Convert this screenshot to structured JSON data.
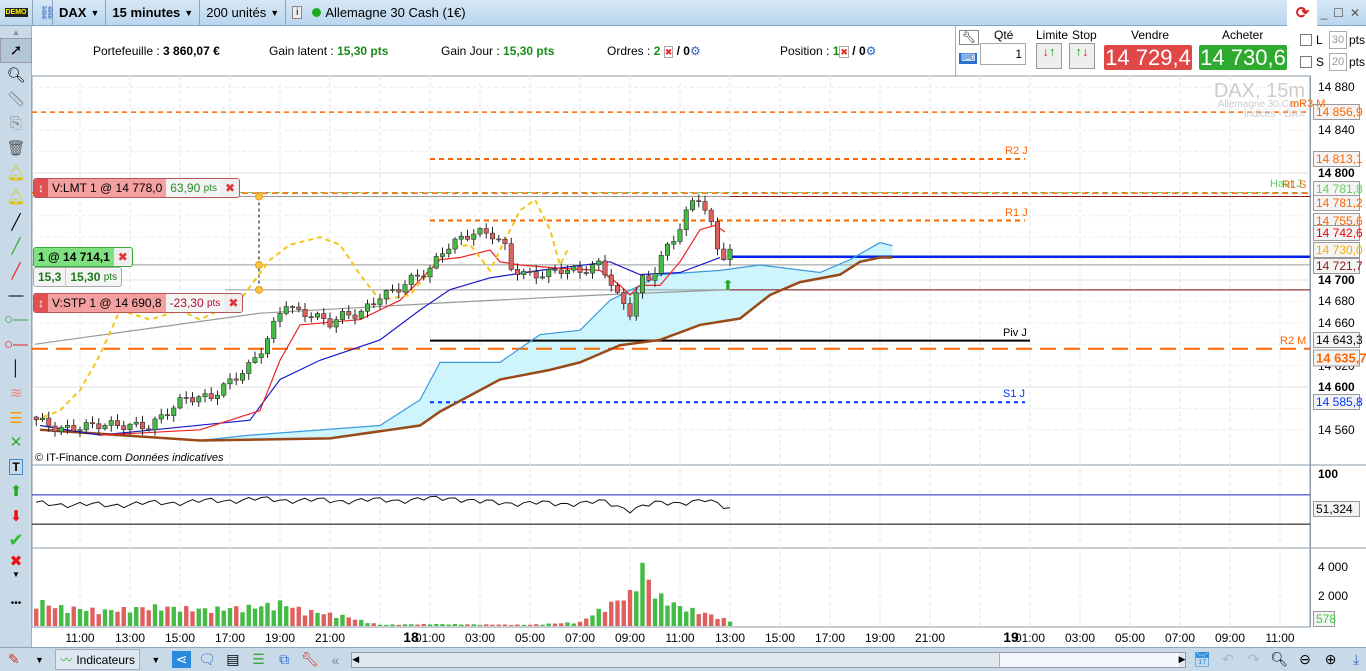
{
  "topbar": {
    "demo": "DEMO",
    "symbol": "DAX",
    "timeframe": "15 minutes",
    "units": "200 unités",
    "instrument": "Allemagne 30 Cash (1€)"
  },
  "infobar": {
    "portfolio_label": "Portefeuille :",
    "portfolio_value": "3 860,07 €",
    "latent_label": "Gain latent :",
    "latent_value": "15,30 pts",
    "day_label": "Gain Jour :",
    "day_value": "15,30 pts",
    "orders_label": "Ordres :",
    "orders_count": "2",
    "orders_sep": "/ 0",
    "position_label": "Position :",
    "position_count": "1",
    "position_sep": "/ 0"
  },
  "orderpanel": {
    "qty_label": "Qté",
    "qty_value": "1",
    "limit_label": "Limite",
    "stop_label": "Stop",
    "sell_label": "Vendre",
    "sell_price": "14 729,4",
    "buy_label": "Acheter",
    "buy_price": "14 730,6",
    "l_label": "L",
    "l_pts": "30",
    "s_label": "S",
    "s_pts": "20",
    "pts": "pts"
  },
  "orders": {
    "limit": {
      "text": "V:LMT  1 @ 14 778,0",
      "pts": "63,90",
      "unit": "pts"
    },
    "entry": {
      "text": "1 @ 14 714,1",
      "pts1": "15,3",
      "pts2": "15,30",
      "unit": "pts"
    },
    "stop": {
      "text": "V:STP  1 @ 14 690,8",
      "pts": "-23,30",
      "unit": "pts"
    }
  },
  "watermark": {
    "title": "DAX, 15m",
    "sub1": "Allemagne 30 Cash",
    "sub2": "Indices - DAX"
  },
  "copyright": {
    "text": "© IT-Finance.com",
    "note": "Données indicatives"
  },
  "levels": [
    {
      "label": "mR3 M",
      "price": 14856.9,
      "color": "#ff6600"
    },
    {
      "label": "R2 J",
      "price": 14813.1,
      "color": "#ff6600"
    },
    {
      "label": "Haut J",
      "price": 14781.8,
      "color": "#66cc66"
    },
    {
      "label": "R1 S",
      "price": 14781.2,
      "color": "#ff6600"
    },
    {
      "label": "R1 J",
      "price": 14755.6,
      "color": "#ff6600"
    },
    {
      "label": "Piv J",
      "price": 14643.3,
      "color": "#000000"
    },
    {
      "label": "R2 M",
      "price": 14635.7,
      "color": "#ff6600"
    },
    {
      "label": "S1 J",
      "price": 14585.8,
      "color": "#0033ff"
    }
  ],
  "price_labels": [
    {
      "text": "14 856,9",
      "price": 14856.9,
      "color": "#ff6600"
    },
    {
      "text": "14 813,1",
      "price": 14813.1,
      "color": "#ff6600"
    },
    {
      "text": "14 781,8",
      "price": 14781.8,
      "color": "#66cc66"
    },
    {
      "text": "14 781,2",
      "price": 14781.2,
      "color": "#ff6600"
    },
    {
      "text": "14 755,6",
      "price": 14755.6,
      "color": "#ff6600"
    },
    {
      "text": "14 742,6",
      "price": 14742.6,
      "color": "#ee0000"
    },
    {
      "text": "14 730,0",
      "price": 14730.0,
      "color": "#f0b000"
    },
    {
      "text": "14 721,7",
      "price": 14721.7,
      "color": "#8b1a1a"
    },
    {
      "text": "14 643,3",
      "price": 14643.3,
      "color": "#000000"
    },
    {
      "text": "14 635,7",
      "price": 14635.7,
      "color": "#ff6600"
    },
    {
      "text": "14 585,8",
      "price": 14585.8,
      "color": "#0033ff"
    }
  ],
  "price_ticks": [
    {
      "text": "14 880",
      "v": 14880
    },
    {
      "text": "14 840",
      "v": 14840
    },
    {
      "text": "14 800",
      "v": 14800,
      "bold": true
    },
    {
      "text": "14 700",
      "v": 14700,
      "bold": true
    },
    {
      "text": "14 680",
      "v": 14680
    },
    {
      "text": "14 660",
      "v": 14660
    },
    {
      "text": "14 620",
      "v": 14620
    },
    {
      "text": "14 600",
      "v": 14600,
      "bold": true
    },
    {
      "text": "14 560",
      "v": 14560
    }
  ],
  "osc": {
    "tick": "100",
    "value_label": "51,324"
  },
  "volume": {
    "ticks": [
      "4 000",
      "2 000"
    ],
    "value_label": "578"
  },
  "time_axis": [
    {
      "t": 11,
      "label": "11:00"
    },
    {
      "t": 13,
      "label": "13:00"
    },
    {
      "t": 15,
      "label": "15:00"
    },
    {
      "t": 17,
      "label": "17:00"
    },
    {
      "t": 19,
      "label": "19:00"
    },
    {
      "t": 21,
      "label": "21:00"
    },
    {
      "t": 24,
      "label": "18",
      "day": true
    },
    {
      "t": 25,
      "label": "01:00"
    },
    {
      "t": 27,
      "label": "03:00"
    },
    {
      "t": 29,
      "label": "05:00"
    },
    {
      "t": 31,
      "label": "07:00"
    },
    {
      "t": 33,
      "label": "09:00"
    },
    {
      "t": 35,
      "label": "11:00"
    },
    {
      "t": 37,
      "label": "13:00"
    },
    {
      "t": 39,
      "label": "15:00"
    },
    {
      "t": 41,
      "label": "17:00"
    },
    {
      "t": 43,
      "label": "19:00"
    },
    {
      "t": 45,
      "label": "21:00"
    },
    {
      "t": 48,
      "label": "19",
      "day": true
    },
    {
      "t": 49,
      "label": "01:00"
    },
    {
      "t": 51,
      "label": "03:00"
    },
    {
      "t": 53,
      "label": "05:00"
    },
    {
      "t": 55,
      "label": "07:00"
    },
    {
      "t": 57,
      "label": "09:00"
    },
    {
      "t": 59,
      "label": "11:00"
    }
  ],
  "bottombar": {
    "indicators": "Indicateurs"
  },
  "chart_data": {
    "type": "candlestick",
    "symbol": "DAX",
    "timeframe": "15m",
    "time_unit": "hours since 17th 00:00",
    "price_path": [
      [
        9.2,
        14570
      ],
      [
        10.2,
        14560
      ],
      [
        11.8,
        14565
      ],
      [
        13.8,
        14563
      ],
      [
        14.4,
        14575
      ],
      [
        15.2,
        14590
      ],
      [
        16.2,
        14590
      ],
      [
        17,
        14605
      ],
      [
        17.8,
        14620
      ],
      [
        18.4,
        14640
      ],
      [
        18.8,
        14660
      ],
      [
        19.2,
        14680
      ],
      [
        19.6,
        14670
      ],
      [
        20.2,
        14668
      ],
      [
        21,
        14660
      ],
      [
        21.6,
        14668
      ],
      [
        22.2,
        14668
      ],
      [
        23,
        14685
      ],
      [
        23.6,
        14690
      ],
      [
        24.2,
        14700
      ],
      [
        25,
        14710
      ],
      [
        25.6,
        14730
      ],
      [
        26.2,
        14738
      ],
      [
        26.8,
        14745
      ],
      [
        27.6,
        14742
      ],
      [
        28,
        14730
      ],
      [
        28.2,
        14712
      ],
      [
        28.8,
        14705
      ],
      [
        29.6,
        14705
      ],
      [
        30.2,
        14710
      ],
      [
        31,
        14708
      ],
      [
        31.8,
        14715
      ],
      [
        32.2,
        14700
      ],
      [
        32.6,
        14680
      ],
      [
        33,
        14670
      ],
      [
        33.4,
        14700
      ],
      [
        33.8,
        14700
      ],
      [
        34.2,
        14720
      ],
      [
        34.8,
        14740
      ],
      [
        35.4,
        14770
      ],
      [
        35.8,
        14778
      ],
      [
        36.2,
        14755
      ],
      [
        36.6,
        14720
      ],
      [
        37,
        14728
      ]
    ],
    "tenkan": [
      [
        11.8,
        14555
      ],
      [
        15.8,
        14560
      ],
      [
        18.2,
        14578
      ],
      [
        19,
        14625
      ],
      [
        19.8,
        14658
      ],
      [
        22.2,
        14663
      ],
      [
        23.8,
        14681
      ],
      [
        25.4,
        14719
      ],
      [
        26.2,
        14721
      ],
      [
        27.4,
        14728
      ],
      [
        27.8,
        14717
      ],
      [
        28.6,
        14714
      ],
      [
        30.2,
        14711
      ],
      [
        31.8,
        14709
      ],
      [
        32.6,
        14695
      ],
      [
        33,
        14686
      ],
      [
        33.4,
        14695
      ],
      [
        34.2,
        14695
      ],
      [
        35,
        14717
      ],
      [
        35.8,
        14747
      ],
      [
        36.4,
        14751
      ],
      [
        36.8,
        14745
      ]
    ],
    "kijun": [
      [
        9.4,
        14564
      ],
      [
        11.8,
        14555
      ],
      [
        17.8,
        14569
      ],
      [
        19,
        14607
      ],
      [
        20.6,
        14625
      ],
      [
        23,
        14644
      ],
      [
        24.6,
        14672
      ],
      [
        25.8,
        14691
      ],
      [
        27.4,
        14702
      ],
      [
        29.4,
        14709
      ],
      [
        32.2,
        14717
      ],
      [
        33.4,
        14705
      ],
      [
        35,
        14707
      ],
      [
        36.6,
        14721
      ]
    ],
    "cloud_upper": [
      [
        9.4,
        14560
      ],
      [
        15.8,
        14550
      ],
      [
        17.8,
        14555
      ],
      [
        23,
        14564
      ],
      [
        24.6,
        14588
      ],
      [
        25.4,
        14623
      ],
      [
        27.8,
        14623
      ],
      [
        29.4,
        14649
      ],
      [
        31,
        14653
      ],
      [
        32.2,
        14681
      ],
      [
        33.4,
        14695
      ],
      [
        34.2,
        14705
      ],
      [
        36.6,
        14709
      ],
      [
        38.2,
        14714
      ],
      [
        40.6,
        14707
      ],
      [
        41.8,
        14719
      ],
      [
        43,
        14735
      ],
      [
        43.5,
        14732
      ]
    ],
    "cloud_lower": [
      [
        9.4,
        14560
      ],
      [
        15.8,
        14550
      ],
      [
        21,
        14552
      ],
      [
        24.6,
        14564
      ],
      [
        25.4,
        14577
      ],
      [
        27.8,
        14607
      ],
      [
        29.8,
        14616
      ],
      [
        31,
        14623
      ],
      [
        32.6,
        14639
      ],
      [
        34.2,
        14644
      ],
      [
        35.8,
        14658
      ],
      [
        37.4,
        14664
      ],
      [
        38.6,
        14686
      ],
      [
        39.8,
        14698
      ],
      [
        41.4,
        14705
      ],
      [
        42.2,
        14717
      ],
      [
        43,
        14721
      ],
      [
        43.5,
        14721
      ]
    ],
    "chikou": [
      [
        9.2,
        14569
      ],
      [
        10.2,
        14578
      ],
      [
        11,
        14597
      ],
      [
        11.8,
        14630
      ],
      [
        12.6,
        14672
      ],
      [
        13.8,
        14663
      ],
      [
        15,
        14672
      ],
      [
        15.8,
        14663
      ],
      [
        17.4,
        14681
      ],
      [
        18.6,
        14719
      ],
      [
        19.4,
        14733
      ],
      [
        20.6,
        14740
      ],
      [
        21.4,
        14733
      ],
      [
        22.2,
        14705
      ],
      [
        23,
        14681
      ],
      [
        24.2,
        14686
      ],
      [
        25,
        14709
      ],
      [
        25.8,
        14730
      ],
      [
        26.6,
        14733
      ],
      [
        27.4,
        14709
      ],
      [
        27.8,
        14728
      ],
      [
        28.6,
        14765
      ],
      [
        29.2,
        14775
      ],
      [
        29.8,
        14747
      ],
      [
        30.2,
        14714
      ],
      [
        30.5,
        14728
      ]
    ],
    "ma": [
      [
        9.2,
        14640
      ],
      [
        18.2,
        14669
      ],
      [
        25.8,
        14679
      ],
      [
        31.8,
        14686
      ],
      [
        37,
        14691
      ]
    ],
    "volume_path": [
      [
        9.25,
        2000
      ],
      [
        10,
        1500
      ],
      [
        12,
        1200
      ],
      [
        14,
        1500
      ],
      [
        16,
        1300
      ],
      [
        18,
        1500
      ],
      [
        19,
        1800
      ],
      [
        20,
        1200
      ],
      [
        21.5,
        800
      ],
      [
        22.5,
        300
      ],
      [
        23,
        100
      ],
      [
        25,
        150
      ],
      [
        27,
        120
      ],
      [
        29,
        100
      ],
      [
        31,
        300
      ],
      [
        32,
        1500
      ],
      [
        33,
        2500
      ],
      [
        33.5,
        4600
      ],
      [
        34,
        2500
      ],
      [
        35,
        1500
      ],
      [
        36,
        1000
      ],
      [
        37,
        400
      ]
    ],
    "osc_path": [
      [
        9.25,
        58
      ],
      [
        12,
        56
      ],
      [
        15,
        60
      ],
      [
        18,
        64
      ],
      [
        21,
        62
      ],
      [
        24,
        63
      ],
      [
        26,
        66
      ],
      [
        27,
        60
      ],
      [
        30,
        58
      ],
      [
        32,
        60
      ],
      [
        33,
        50
      ],
      [
        34,
        58
      ],
      [
        36,
        62
      ],
      [
        37,
        52
      ]
    ],
    "osc_levels": [
      70,
      30
    ]
  }
}
